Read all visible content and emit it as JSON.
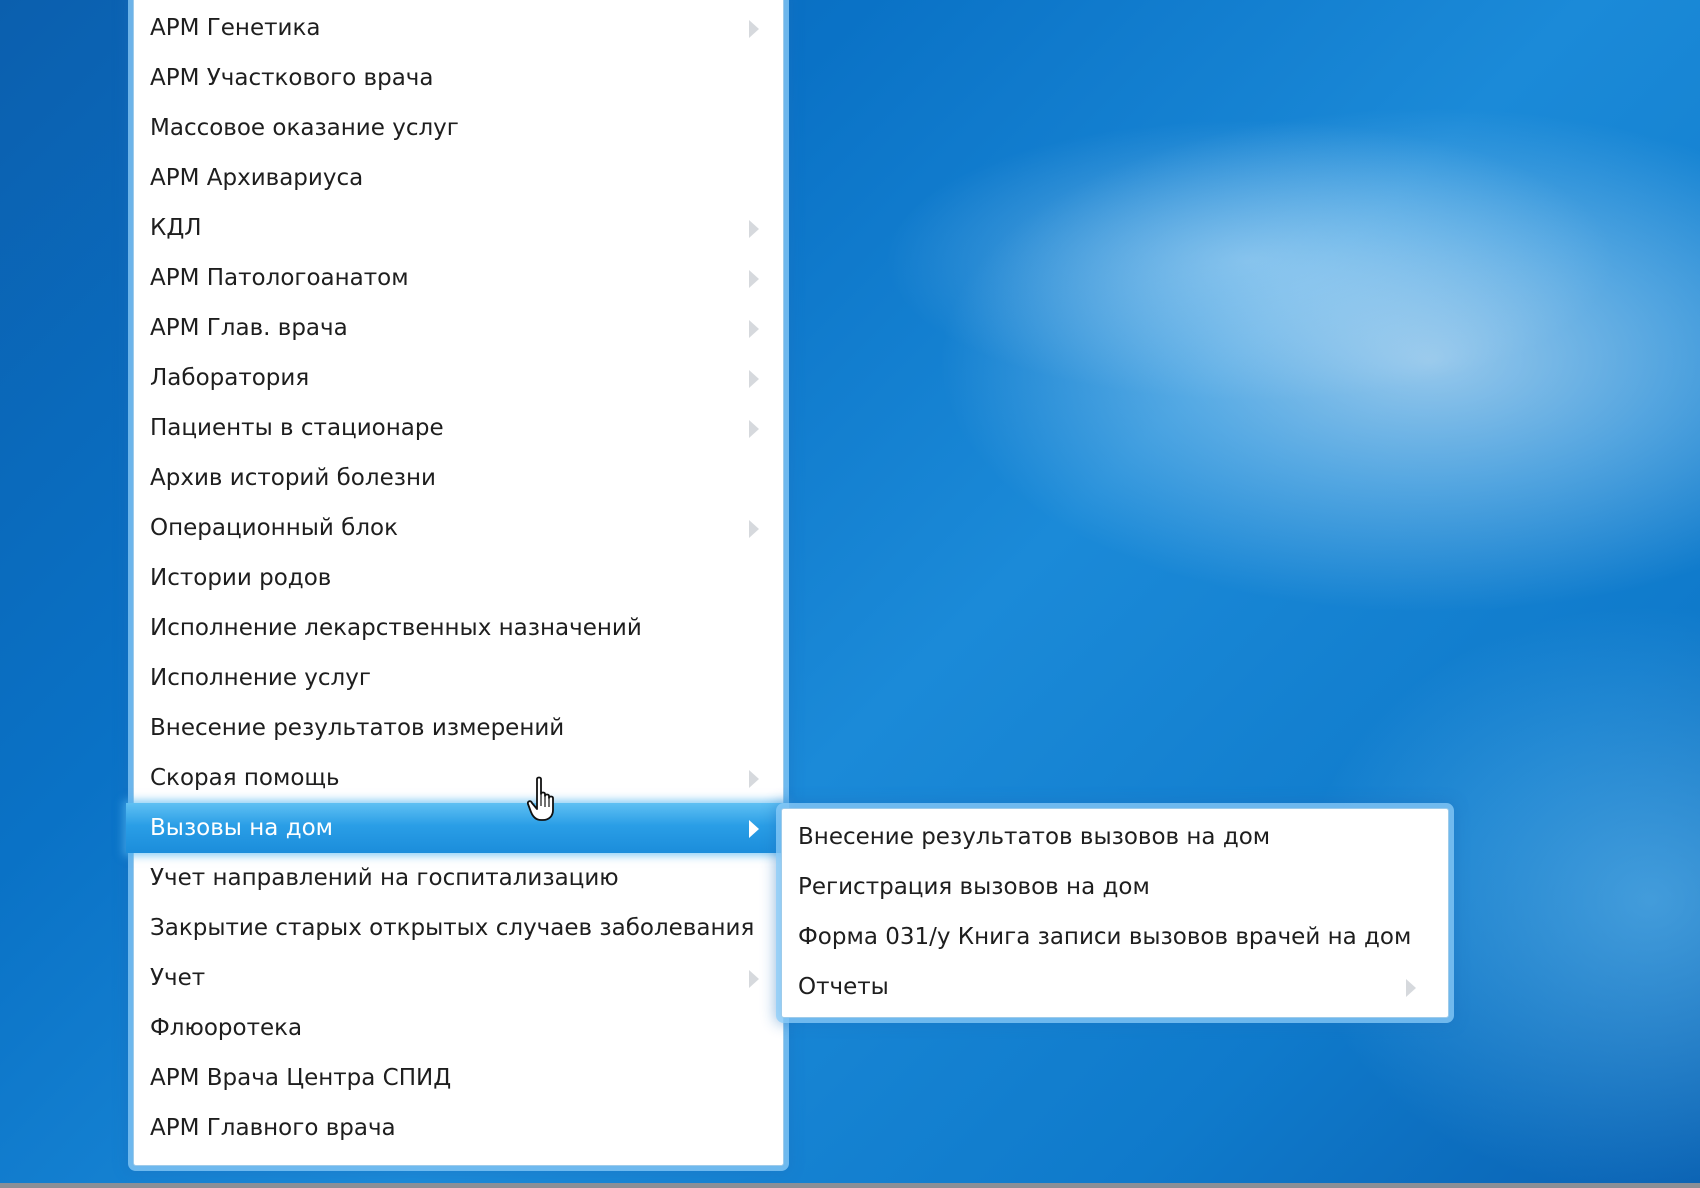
{
  "main_menu": {
    "items": [
      {
        "label": "АРМ Генетика",
        "has_submenu": true
      },
      {
        "label": "АРМ Участкового врача",
        "has_submenu": false
      },
      {
        "label": "Массовое оказание услуг",
        "has_submenu": false
      },
      {
        "label": "АРМ Архивариуса",
        "has_submenu": false
      },
      {
        "label": "КДЛ",
        "has_submenu": true
      },
      {
        "label": "АРМ Патологоанатом",
        "has_submenu": true
      },
      {
        "label": "АРМ Глав. врача",
        "has_submenu": true
      },
      {
        "label": "Лаборатория",
        "has_submenu": true
      },
      {
        "label": "Пациенты в стационаре",
        "has_submenu": true
      },
      {
        "label": "Архив историй болезни",
        "has_submenu": false
      },
      {
        "label": "Операционный блок",
        "has_submenu": true
      },
      {
        "label": "Истории родов",
        "has_submenu": false
      },
      {
        "label": "Исполнение лекарственных назначений",
        "has_submenu": false
      },
      {
        "label": "Исполнение услуг",
        "has_submenu": false
      },
      {
        "label": "Внесение результатов измерений",
        "has_submenu": false
      },
      {
        "label": "Скорая помощь",
        "has_submenu": true
      },
      {
        "label": "Вызовы на дом",
        "has_submenu": true,
        "active": true
      },
      {
        "label": "Учет направлений на госпитализацию",
        "has_submenu": false
      },
      {
        "label": "Закрытие старых открытых случаев заболевания",
        "has_submenu": false
      },
      {
        "label": "Учет",
        "has_submenu": true
      },
      {
        "label": "Флюоротека",
        "has_submenu": false
      },
      {
        "label": "АРМ Врача Центра СПИД",
        "has_submenu": false
      },
      {
        "label": "АРМ Главного врача",
        "has_submenu": false
      }
    ]
  },
  "sub_menu": {
    "items": [
      {
        "label": "Внесение результатов вызовов на дом",
        "has_submenu": false
      },
      {
        "label": "Регистрация вызовов на дом",
        "has_submenu": false
      },
      {
        "label": "Форма 031/у Книга записи вызовов врачей на дом",
        "has_submenu": false
      },
      {
        "label": "Отчеты",
        "has_submenu": true
      }
    ]
  },
  "cursor": {
    "icon": "hand-pointer-icon"
  },
  "colors": {
    "desktop_blue": "#0a6fc0",
    "menu_highlight": "#2a9ee6",
    "menu_glow": "#8ccdfa",
    "menu_text": "#1e1e1e",
    "submenu_arrow": "#d6d9dd"
  }
}
